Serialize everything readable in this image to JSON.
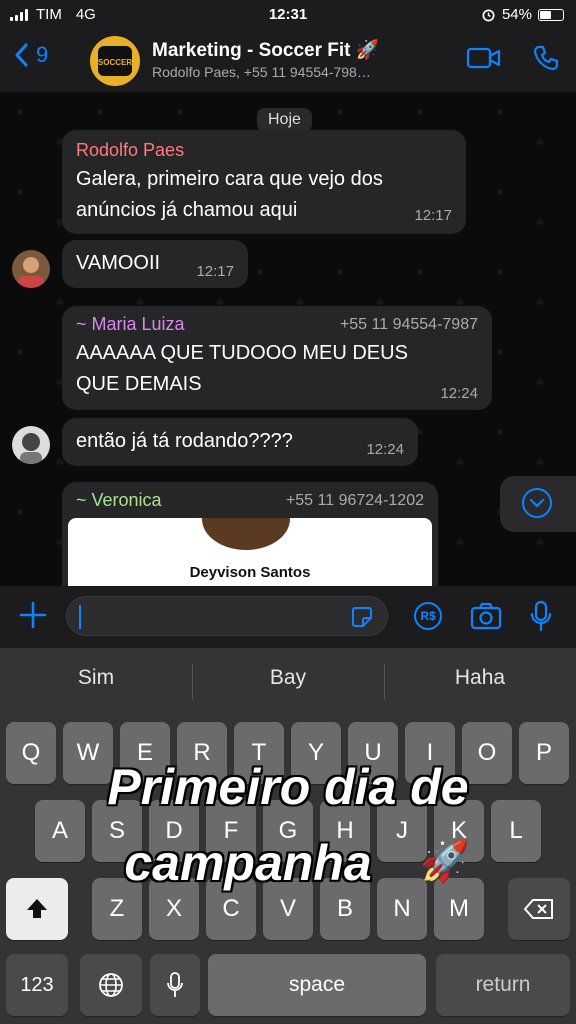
{
  "status_bar": {
    "carrier": "TIM",
    "network": "4G",
    "time": "12:31",
    "battery": "54%",
    "battery_level": 0.54
  },
  "header": {
    "back_count": "9",
    "title": "Marketing - Soccer Fit 🚀",
    "subtitle": "Rodolfo Paes, +55 11 94554-798…",
    "avatar_text": "SOCCER FIT"
  },
  "chat": {
    "date_label": "Hoje",
    "messages": [
      {
        "sender": "Rodolfo Paes",
        "sender_color": "#ff7a7a",
        "lines": [
          "Galera, primeiro cara que vejo dos",
          "anúncios já chamou aqui"
        ],
        "time": "12:17"
      },
      {
        "text": "VAMOOII",
        "time": "12:17"
      },
      {
        "sender": "~ Maria Luiza",
        "sender_color": "#d889e8",
        "phone": "+55 11 94554-7987",
        "lines": [
          "AAAAAA QUE TUDOOO MEU DEUS",
          "QUE DEMAIS"
        ],
        "time": "12:24"
      },
      {
        "text": "então já tá rodando????",
        "time": "12:24"
      },
      {
        "sender": "~ Veronica",
        "sender_color": "#a6e28b",
        "phone": "+55 11 96724-1202",
        "card_name": "Deyvison Santos"
      }
    ]
  },
  "composer": {
    "placeholder": "",
    "rs_label": "R$"
  },
  "keyboard": {
    "suggestions": [
      "Sim",
      "Bay",
      "Haha"
    ],
    "row1": [
      "Q",
      "W",
      "E",
      "R",
      "T",
      "Y",
      "U",
      "I",
      "O",
      "P"
    ],
    "row2": [
      "A",
      "S",
      "D",
      "F",
      "G",
      "H",
      "J",
      "K",
      "L"
    ],
    "row3": [
      "Z",
      "X",
      "C",
      "V",
      "B",
      "N",
      "M"
    ],
    "numbers_label": "123",
    "space_label": "space",
    "return_label": "return"
  },
  "overlay": {
    "line1": "Primeiro dia de",
    "line2": "campanha",
    "emoji": "🚀"
  },
  "colors": {
    "accent": "#0a84ff",
    "bubble": "#262628",
    "background": "#0b0b0b"
  }
}
